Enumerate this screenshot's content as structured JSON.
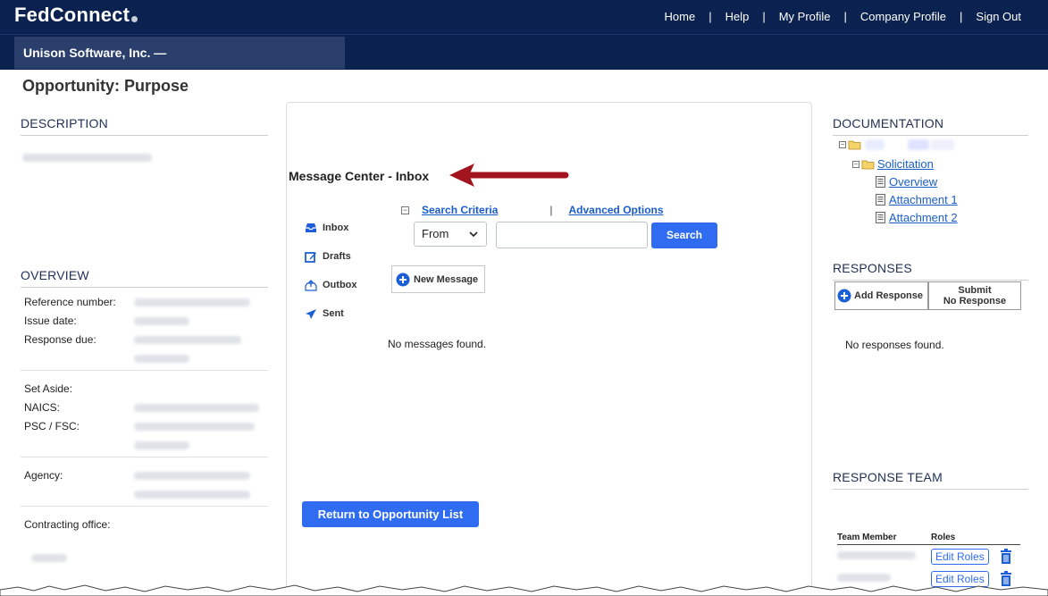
{
  "header": {
    "brand": "FedConnect",
    "nav": [
      "Home",
      "Help",
      "My Profile",
      "Company Profile",
      "Sign Out"
    ],
    "company": "Unison Software, Inc. —"
  },
  "page": {
    "title": "Opportunity: Purpose"
  },
  "left": {
    "description_heading": "DESCRIPTION",
    "overview_heading": "OVERVIEW",
    "overview_labels": {
      "reference_number": "Reference number:",
      "issue_date": "Issue date:",
      "response_due": "Response due:",
      "set_aside": "Set Aside:",
      "naics": "NAICS:",
      "psc_fsc": "PSC / FSC:",
      "agency": "Agency:",
      "contracting_office": "Contracting office:"
    }
  },
  "message_center": {
    "title": "Message Center - Inbox",
    "folders": [
      {
        "label": "Inbox",
        "icon": "inbox-icon"
      },
      {
        "label": "Drafts",
        "icon": "edit-icon"
      },
      {
        "label": "Outbox",
        "icon": "outbox-icon"
      },
      {
        "label": "Sent",
        "icon": "send-icon"
      }
    ],
    "search_criteria_link": "Search Criteria",
    "divider": "|",
    "advanced_options_link": "Advanced Options",
    "filter_selected": "From",
    "search_button": "Search",
    "new_message_button": "New Message",
    "empty_text": "No messages found.",
    "return_button": "Return to Opportunity List"
  },
  "right": {
    "documentation_heading": "DOCUMENTATION",
    "tree": {
      "folder": "Solicitation",
      "files": [
        "Overview",
        "Attachment 1",
        "Attachment 2"
      ]
    },
    "responses_heading": "RESPONSES",
    "add_response_button": "Add Response",
    "submit_no_response_line1": "Submit",
    "submit_no_response_line2": "No Response",
    "no_responses_text": "No responses found.",
    "team_heading": "RESPONSE TEAM",
    "team_columns": [
      "Team Member",
      "Roles"
    ],
    "edit_roles_label": "Edit Roles"
  },
  "colors": {
    "header_bg": "#0b2250",
    "accent_blue": "#2f6cf2",
    "arrow_red": "#a3141e"
  }
}
